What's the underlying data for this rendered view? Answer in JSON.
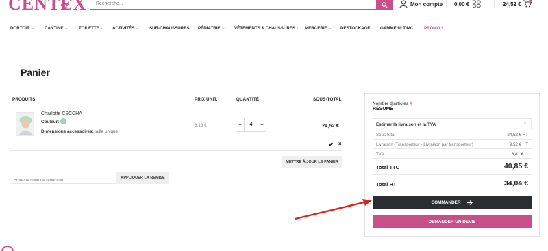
{
  "brand": {
    "logo_text": "CENTEX",
    "accent": "#c94f8a",
    "dark": "#2a2e30"
  },
  "header": {
    "search_placeholder": "Recherche...",
    "account_label": "Mon compte",
    "wishlist_amount": "0,00 €",
    "cart_amount": "24,52 €"
  },
  "nav": {
    "items": [
      {
        "label": "DORTOIR",
        "has_dropdown": true
      },
      {
        "label": "CANTINE",
        "has_dropdown": true
      },
      {
        "label": "TOILETTE",
        "has_dropdown": true
      },
      {
        "label": "ACTIVITÉS",
        "has_dropdown": true
      },
      {
        "label": "SUR-CHAUSSURES",
        "has_dropdown": false
      },
      {
        "label": "PÉDIATRIE",
        "has_dropdown": true
      },
      {
        "label": "VÊTEMENTS & CHAUSSURES",
        "has_dropdown": true
      },
      {
        "label": "MERCERIE",
        "has_dropdown": true
      },
      {
        "label": "DESTOCKAGE",
        "has_dropdown": false
      },
      {
        "label": "GAMME ULTIMC",
        "has_dropdown": false
      },
      {
        "label": "PROMO !",
        "has_dropdown": false
      }
    ]
  },
  "page": {
    "title": "Panier"
  },
  "cart": {
    "columns": {
      "product": "PRODUITS",
      "unit_price": "PRIX UNIT.",
      "quantity": "QUANTITÉ",
      "subtotal": "SOUS-TOTAL"
    },
    "item": {
      "name": "Charlotte CSCCHA",
      "color_label": "Couleur:",
      "color_value": "#a9d3b9",
      "accessory_label": "Dimensions accessoires:",
      "accessory_value": "taille unique",
      "unit_price": "6,13 €",
      "quantity": "4",
      "subtotal": "24,52 €"
    },
    "update_button": "METTRE À JOUR LE PANIER",
    "coupon_placeholder": "Entrer le code de réduction",
    "coupon_button": "APPLIQUER LA REMISE"
  },
  "summary": {
    "count_label": "Nombre d'articles",
    "count_value": "4",
    "title": "RÉSUMÉ",
    "shipping_estimate": "Estimer la livraison et la TVA",
    "rows": [
      {
        "label": "Sous-total",
        "value": "24,52 € HT"
      },
      {
        "label": "Livraison (Transporteur - Livraison par transporteur)",
        "value": "9,52 € HT"
      },
      {
        "label": "TVA",
        "value": "6,81 €"
      }
    ],
    "total_ttc_label": "Total TTC",
    "total_ttc_value": "40,85 €",
    "total_ht_label": "Total HT",
    "total_ht_value": "34,04 €",
    "order_button": "COMMANDER",
    "quote_button": "DEMANDER UN DEVIS"
  }
}
